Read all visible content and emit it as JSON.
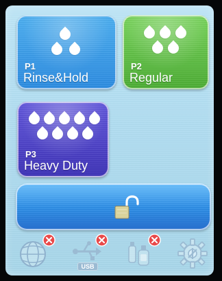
{
  "programs": [
    {
      "code": "P1",
      "name": "Rinse&Hold"
    },
    {
      "code": "P2",
      "name": "Regular"
    },
    {
      "code": "P3",
      "name": "Heavy Duty"
    }
  ],
  "bottom_bar": {
    "usb_label": "USB"
  },
  "icons": {
    "lock": "unlocked-padlock-icon",
    "network": "network-globe-icon",
    "usb": "usb-icon",
    "chemicals": "chemical-bottles-icon",
    "settings": "gear-settings-icon",
    "error_badge": "red-x-badge-icon"
  },
  "colors": {
    "screen_bg": "#b9e1f4",
    "p1": "#3a9be7",
    "p2": "#62c44a",
    "p3": "#5148cb",
    "lock_bar": "#2f8fe7",
    "badge_red": "#e84a4a"
  }
}
